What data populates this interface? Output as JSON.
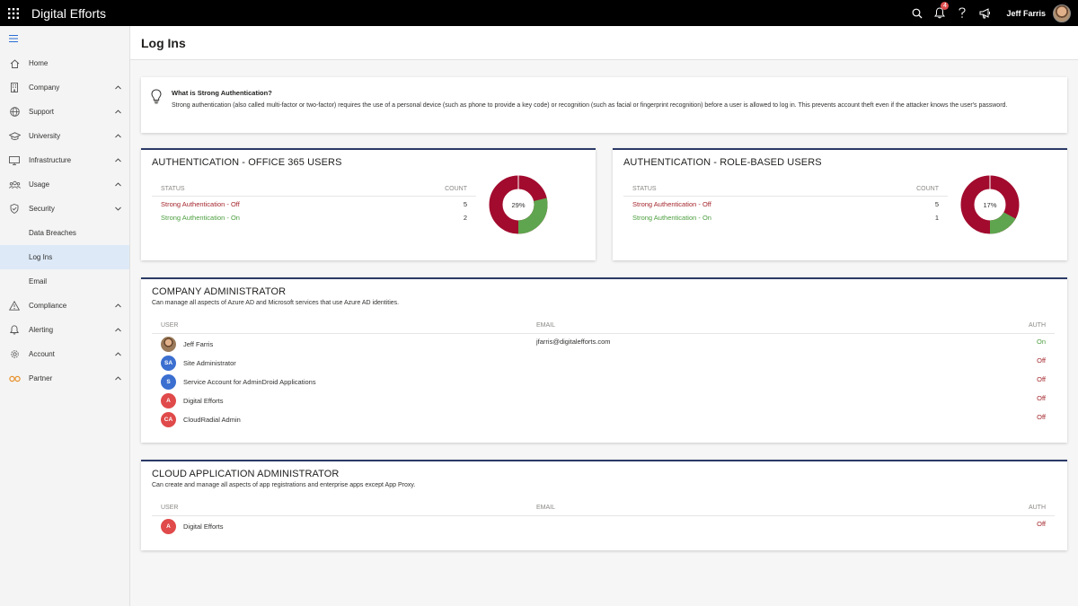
{
  "app": {
    "title": "Digital Efforts"
  },
  "topbar": {
    "username": "Jeff Farris",
    "notification_count": "4"
  },
  "sidebar": {
    "items": [
      {
        "label": "Home",
        "icon": "home-icon"
      },
      {
        "label": "Company",
        "icon": "building-icon"
      },
      {
        "label": "Support",
        "icon": "globe-icon"
      },
      {
        "label": "University",
        "icon": "graduation-cap-icon"
      },
      {
        "label": "Infrastructure",
        "icon": "monitor-icon"
      },
      {
        "label": "Usage",
        "icon": "people-icon"
      },
      {
        "label": "Security",
        "icon": "shield-icon"
      },
      {
        "label": "Compliance",
        "icon": "warning-icon"
      },
      {
        "label": "Alerting",
        "icon": "bell-icon"
      },
      {
        "label": "Account",
        "icon": "gear-icon"
      },
      {
        "label": "Partner",
        "icon": "partner-icon"
      }
    ],
    "security_sub": [
      {
        "label": "Data Breaches"
      },
      {
        "label": "Log Ins"
      },
      {
        "label": "Email"
      }
    ]
  },
  "page": {
    "title": "Log Ins"
  },
  "info": {
    "title": "What is Strong Authentication?",
    "text": "Strong authentication (also called multi-factor or two-factor) requires the use of a personal device (such as phone to provide a key code) or recognition (such as facial or fingerprint recognition) before a user is allowed to log in. This prevents account theft even if the attacker knows the user's password."
  },
  "auth_office": {
    "title": "AUTHENTICATION - OFFICE 365 USERS",
    "col_status": "STATUS",
    "col_count": "COUNT",
    "rows": [
      {
        "status": "Strong Authentication - Off",
        "count": "5"
      },
      {
        "status": "Strong Authentication - On",
        "count": "2"
      }
    ],
    "donut_label": "29%"
  },
  "auth_role": {
    "title": "AUTHENTICATION - ROLE-BASED USERS",
    "col_status": "STATUS",
    "col_count": "COUNT",
    "rows": [
      {
        "status": "Strong Authentication - Off",
        "count": "5"
      },
      {
        "status": "Strong Authentication - On",
        "count": "1"
      }
    ],
    "donut_label": "17%"
  },
  "company_admin": {
    "title": "COMPANY ADMINISTRATOR",
    "subtitle": "Can manage all aspects of Azure AD and Microsoft services that use Azure AD identities.",
    "col_user": "USER",
    "col_email": "EMAIL",
    "col_auth": "AUTH",
    "rows": [
      {
        "initials": "",
        "name": "Jeff Farris",
        "email": "jfarris@digitalefforts.com",
        "auth": "On"
      },
      {
        "initials": "SA",
        "name": "Site Administrator",
        "email": "",
        "auth": "Off"
      },
      {
        "initials": "S",
        "name": "Service Account for AdminDroid Applications",
        "email": "",
        "auth": "Off"
      },
      {
        "initials": "A",
        "name": "Digital Efforts",
        "email": "",
        "auth": "Off"
      },
      {
        "initials": "CA",
        "name": "CloudRadial Admin",
        "email": "",
        "auth": "Off"
      }
    ]
  },
  "cloud_admin": {
    "title": "CLOUD APPLICATION ADMINISTRATOR",
    "subtitle": "Can create and manage all aspects of app registrations and enterprise apps except App Proxy.",
    "col_user": "USER",
    "col_email": "EMAIL",
    "col_auth": "AUTH",
    "rows": [
      {
        "initials": "A",
        "name": "Digital Efforts",
        "email": "",
        "auth": "Off"
      }
    ]
  },
  "colors": {
    "off": "#a4262c",
    "on": "#4b9e3e",
    "donut_off": "#a20b2e",
    "donut_on": "#5fa54f",
    "accent": "#2b3a67",
    "avatar_blue": "#3b6fd0",
    "avatar_red": "#e04a4a"
  }
}
